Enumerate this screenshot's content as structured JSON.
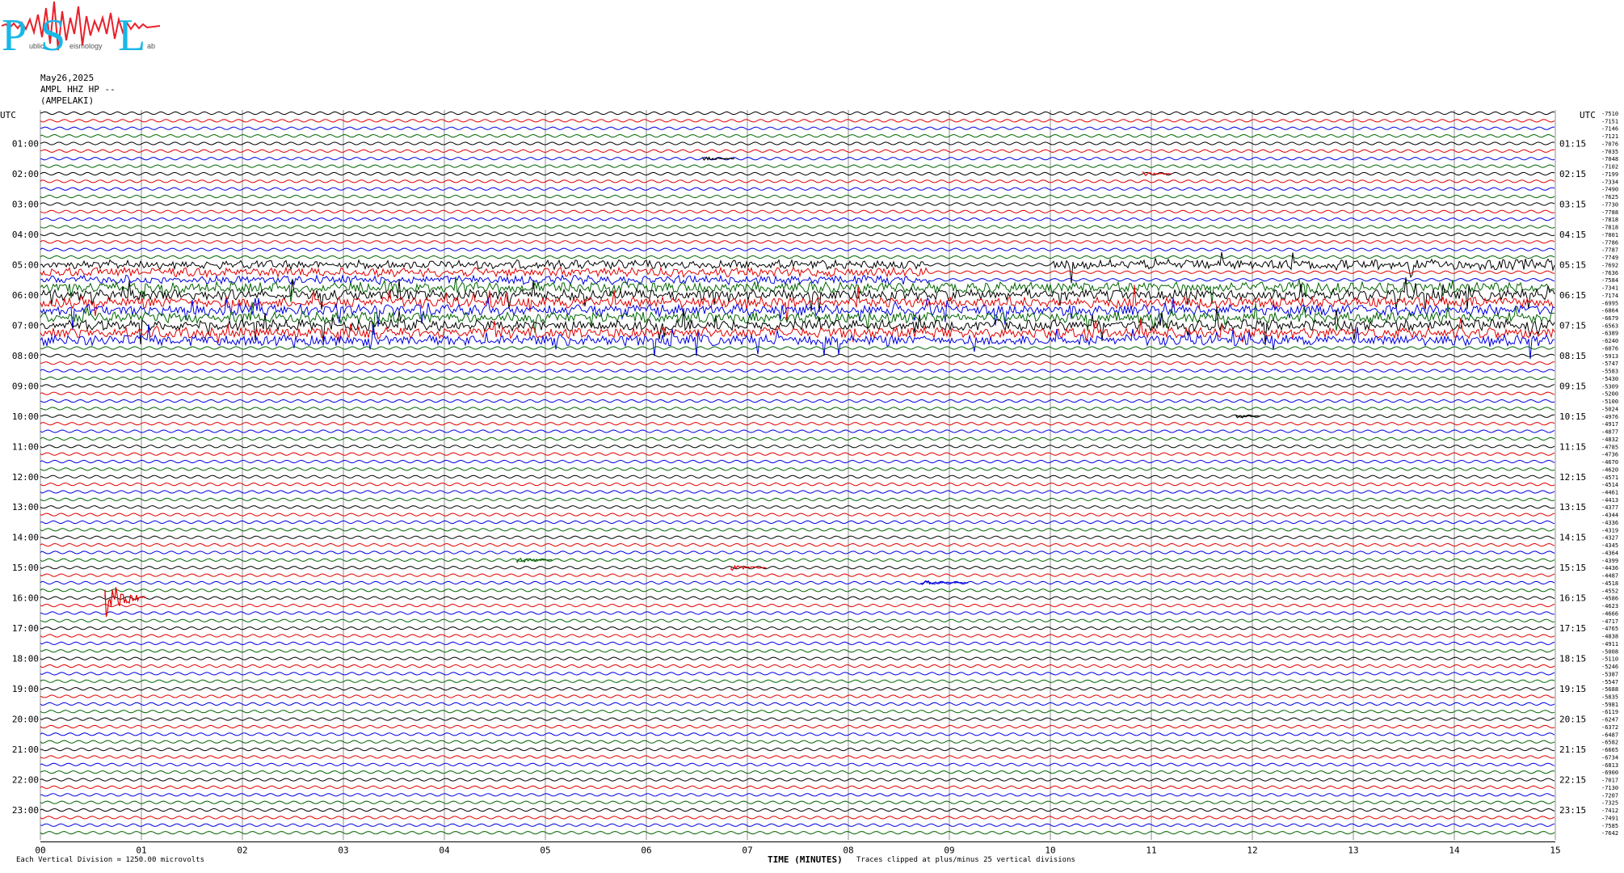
{
  "logo": {
    "letters": [
      "P",
      "S",
      "L"
    ],
    "text_fragments": [
      "ublic",
      "eismology",
      "ab"
    ],
    "colors": {
      "letters": "#1ab7e6",
      "trace": "#e8202a"
    }
  },
  "header": {
    "date": "May26,2025",
    "channel": "AMPL HHZ HP --",
    "station": "(AMPELAKI)"
  },
  "left_axis": {
    "title": "UTC",
    "labels": [
      "01:00",
      "02:00",
      "03:00",
      "04:00",
      "05:00",
      "06:00",
      "07:00",
      "08:00",
      "09:00",
      "10:00",
      "11:00",
      "12:00",
      "13:00",
      "14:00",
      "15:00",
      "16:00",
      "17:00",
      "18:00",
      "19:00",
      "20:00",
      "21:00",
      "22:00",
      "23:00"
    ]
  },
  "right_axis": {
    "title": "UTC",
    "labels": [
      "01:15",
      "02:15",
      "03:15",
      "04:15",
      "05:15",
      "06:15",
      "07:15",
      "08:15",
      "09:15",
      "10:15",
      "11:15",
      "12:15",
      "13:15",
      "14:15",
      "15:15",
      "16:15",
      "17:15",
      "18:15",
      "19:15",
      "20:15",
      "21:15",
      "22:15",
      "23:15"
    ]
  },
  "offsets": [
    "-7510",
    "-7151",
    "-7146",
    "-7121",
    "-7076",
    "-7035",
    "-7048",
    "-7102",
    "-7199",
    "-7334",
    "-7490",
    "-7625",
    "-7730",
    "-7788",
    "-7818",
    "-7818",
    "-7801",
    "-7786",
    "-7787",
    "-7749",
    "-7692",
    "-7636",
    "-7584",
    "-7341",
    "-7174",
    "-6995",
    "-6864",
    "-6679",
    "-6563",
    "-6389",
    "-6240",
    "-6076",
    "-5913",
    "-5747",
    "-5583",
    "-5430",
    "-5309",
    "-5200",
    "-5100",
    "-5024",
    "-4976",
    "-4917",
    "-4877",
    "-4832",
    "-4785",
    "-4736",
    "-4670",
    "-4620",
    "-4571",
    "-4514",
    "-4461",
    "-4413",
    "-4377",
    "-4344",
    "-4336",
    "-4319",
    "-4327",
    "-4345",
    "-4364",
    "-4399",
    "-4436",
    "-4487",
    "-4518",
    "-4552",
    "-4586",
    "-4623",
    "-4666",
    "-4717",
    "-4765",
    "-4838",
    "-4911",
    "-5008",
    "-5110",
    "-5246",
    "-5387",
    "-5547",
    "-5688",
    "-5835",
    "-5981",
    "-6119",
    "-6247",
    "-6372",
    "-6487",
    "-6582",
    "-6665",
    "-6734",
    "-6813",
    "-6900",
    "-7017",
    "-7130",
    "-7207",
    "-7325",
    "-7412",
    "-7491",
    "-7585",
    "-7642"
  ],
  "x_axis": {
    "title": "TIME (MINUTES)",
    "ticks": [
      "00",
      "01",
      "02",
      "03",
      "04",
      "05",
      "06",
      "07",
      "08",
      "09",
      "10",
      "11",
      "12",
      "13",
      "14",
      "15"
    ]
  },
  "footer": {
    "scale": "Each Vertical Division = 1250.00 microvolts",
    "clip": "Traces clipped at plus/minus 25 vertical divisions"
  },
  "trace_colors": [
    "#000000",
    "#e00000",
    "#0000e0",
    "#006400"
  ],
  "grid_color": "#8c8c8c",
  "chart_data": {
    "type": "helicorder",
    "rows": 96,
    "minutes_per_row": 15,
    "x_range_minutes": [
      0,
      15
    ]
  }
}
